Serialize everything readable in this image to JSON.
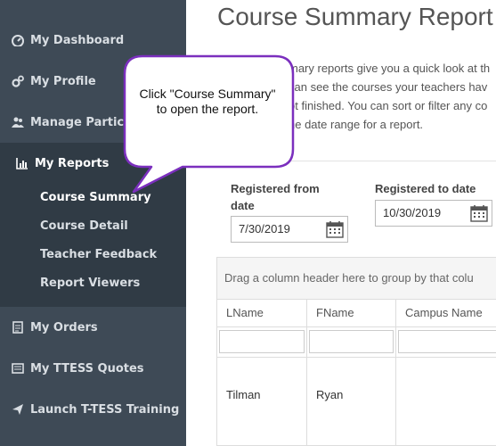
{
  "sidebar": {
    "items": [
      {
        "label": "My Dashboard",
        "icon": "dashboard-icon"
      },
      {
        "label": "My Profile",
        "icon": "cogs-icon"
      },
      {
        "label": "Manage Participants",
        "icon": "users-icon"
      },
      {
        "label": "My Reports",
        "icon": "bar-chart-icon"
      },
      {
        "label": "My Orders",
        "icon": "document-icon"
      },
      {
        "label": "My TTESS Quotes",
        "icon": "quotes-icon"
      },
      {
        "label": "Launch T-TESS Training",
        "icon": "send-icon"
      }
    ],
    "reports_submenu": [
      "Course Summary",
      "Course Detail",
      "Teacher Feedback",
      "Report Viewers"
    ],
    "colors": {
      "background": "#3e4a56",
      "submenu_background": "#303b45",
      "text": "#d9dee3"
    }
  },
  "main": {
    "title": "Course Summary Report",
    "intro_lines": [
      "mary reports give you a quick look at th",
      "can see the courses your teachers hav",
      "ot finished. You can sort or filter any co",
      "he date range for a report."
    ],
    "filters": {
      "from_label": "Registered from date",
      "from_value": "7/30/2019",
      "to_label": "Registered to date",
      "to_value": "10/30/2019"
    },
    "grid": {
      "group_hint": "Drag a column header here to group by that colu",
      "columns": [
        "LName",
        "FName",
        "Campus Name"
      ],
      "rows": [
        {
          "LName": "Tilman",
          "FName": "Ryan",
          "Campus Name": ""
        }
      ]
    }
  },
  "callout": {
    "text": "Click \"Course Summary\" to open the report.",
    "border_color": "#7b2fbe"
  }
}
